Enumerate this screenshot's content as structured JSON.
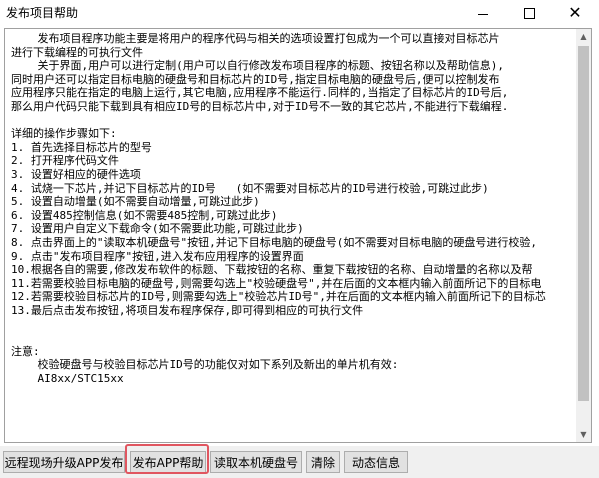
{
  "window": {
    "title": "发布项目帮助",
    "minimize_icon": "minimize-icon",
    "maximize_icon": "maximize-icon",
    "close_icon": "close-icon"
  },
  "help_text": {
    "lines": [
      "    发布项目程序功能主要是将用户的程序代码与相关的选项设置打包成为一个可以直接对目标芯片",
      "进行下载编程的可执行文件",
      "    关于界面,用户可以进行定制(用户可以自行修改发布项目程序的标题、按钮名称以及帮助信息),",
      "同时用户还可以指定目标电脑的硬盘号和目标芯片的ID号,指定目标电脑的硬盘号后,便可以控制发布",
      "应用程序只能在指定的电脑上运行,其它电脑,应用程序不能运行.同样的,当指定了目标芯片的ID号后,",
      "那么用户代码只能下载到具有相应ID号的目标芯片中,对于ID号不一致的其它芯片,不能进行下载编程.",
      "",
      "详细的操作步骤如下:",
      "1. 首先选择目标芯片的型号",
      "2. 打开程序代码文件",
      "3. 设置好相应的硬件选项",
      "4. 试烧一下芯片,并记下目标芯片的ID号   (如不需要对目标芯片的ID号进行校验,可跳过此步)",
      "5. 设置自动增量(如不需要自动增量,可跳过此步)",
      "6. 设置485控制信息(如不需要485控制,可跳过此步)",
      "7. 设置用户自定义下载命令(如不需要此功能,可跳过此步)",
      "8. 点击界面上的\"读取本机硬盘号\"按钮,并记下目标电脑的硬盘号(如不需要对目标电脑的硬盘号进行校验,",
      "9. 点击\"发布项目程序\"按钮,进入发布应用程序的设置界面",
      "10.根据各自的需要,修改发布软件的标题、下载按钮的名称、重复下载按钮的名称、自动增量的名称以及帮",
      "11.若需要校验目标电脑的硬盘号,则需要勾选上\"校验硬盘号\",并在后面的文本框内输入前面所记下的目标电",
      "12.若需要校验目标芯片的ID号,则需要勾选上\"校验芯片ID号\",并在后面的文本框内输入前面所记下的目标芯",
      "13.最后点击发布按钮,将项目发布程序保存,即可得到相应的可执行文件",
      "",
      "",
      "注意:",
      "    校验硬盘号与校验目标芯片ID号的功能仅对如下系列及新出的单片机有效:",
      "    AI8xx/STC15xx"
    ]
  },
  "buttons": {
    "remote_upgrade": "远程现场升级APP发布",
    "publish_help": "发布APP帮助",
    "read_disk": "读取本机硬盘号",
    "clear": "清除",
    "dynamic_info": "动态信息"
  },
  "colors": {
    "highlight_border": "#e05660",
    "button_bg": "#e1e1e1",
    "toolbar_bg": "#f0f0f0"
  }
}
